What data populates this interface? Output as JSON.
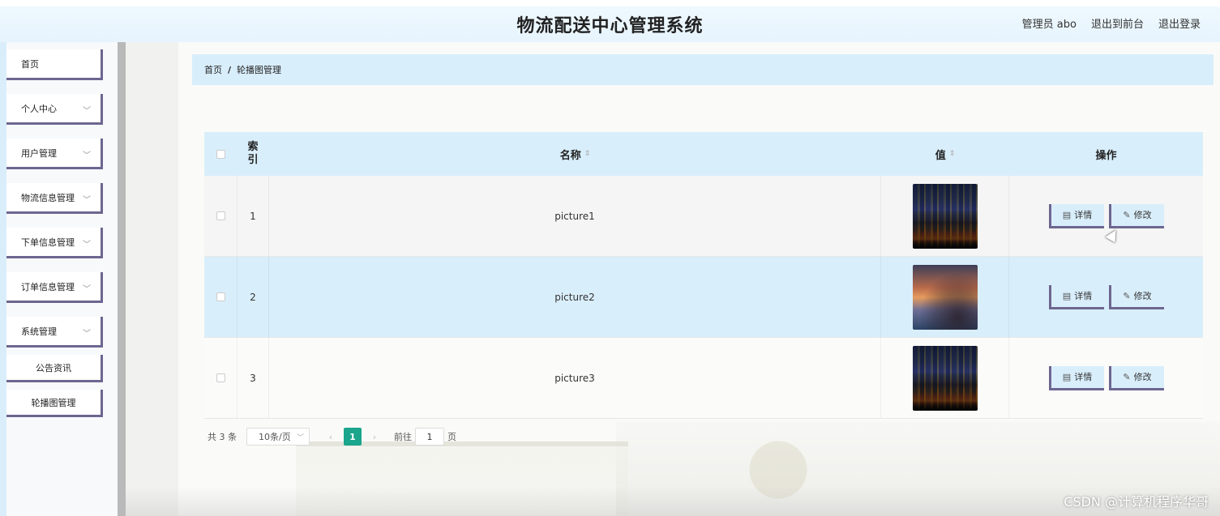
{
  "header": {
    "title": "物流配送中心管理系统",
    "user_label": "管理员 abo",
    "front_link": "退出到前台",
    "logout_link": "退出登录"
  },
  "sidebar": {
    "items": [
      {
        "label": "首页",
        "expandable": false
      },
      {
        "label": "个人中心",
        "expandable": true
      },
      {
        "label": "用户管理",
        "expandable": true
      },
      {
        "label": "物流信息管理",
        "expandable": true
      },
      {
        "label": "下单信息管理",
        "expandable": true
      },
      {
        "label": "订单信息管理",
        "expandable": true
      },
      {
        "label": "系统管理",
        "expandable": true
      }
    ],
    "sub_items": [
      {
        "label": "公告资讯"
      },
      {
        "label": "轮播图管理"
      }
    ]
  },
  "breadcrumb": {
    "home": "首页",
    "separator": "/",
    "current": "轮播图管理"
  },
  "table": {
    "headers": {
      "index": "索\n引",
      "index_line1": "索",
      "index_line2": "引",
      "name": "名称",
      "value": "值",
      "actions": "操作"
    },
    "rows": [
      {
        "index": "1",
        "name": "picture1",
        "image": "city-night"
      },
      {
        "index": "2",
        "name": "picture2",
        "image": "coast-sunset"
      },
      {
        "index": "3",
        "name": "picture3",
        "image": "city-night"
      }
    ],
    "detail_label": "详情",
    "edit_label": "修改"
  },
  "pagination": {
    "total": "共 3 条",
    "page_size": "10条/页",
    "current_page": "1",
    "goto_label": "前往",
    "goto_value": "1",
    "page_suffix": "页"
  },
  "watermark": "CSDN @计算机程序华哥",
  "colors": {
    "header_bg": "#e7f4fd",
    "accent_light": "#d9eefb",
    "button_border": "#6d6690",
    "page_active": "#1aa58c"
  },
  "icons": {
    "detail": "document-icon",
    "edit": "pencil-icon",
    "sort": "sort-icon",
    "chevron": "chevron-down-icon"
  }
}
